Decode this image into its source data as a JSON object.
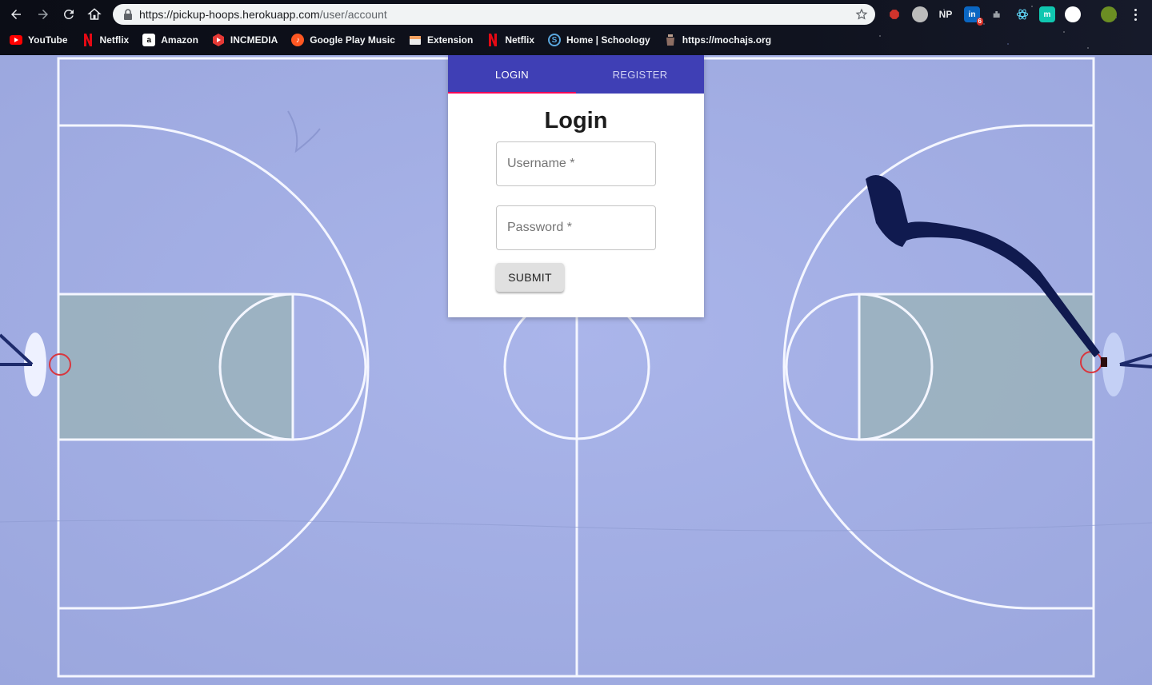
{
  "browser": {
    "url_host": "https://pickup-hoops.herokuapp.com",
    "url_path": "/user/account",
    "extensions": [
      {
        "name": "adblock-icon",
        "color": "#d0342c",
        "text": ""
      },
      {
        "name": "circle-ext-icon",
        "color": "#bbbbbb",
        "text": ""
      },
      {
        "name": "np-icon",
        "color": "transparent",
        "text": "NP"
      },
      {
        "name": "linkedin-icon",
        "color": "#0a66c2",
        "text": "in",
        "badge": "6"
      },
      {
        "name": "puzzle-ext-icon",
        "color": "transparent",
        "text": ""
      },
      {
        "name": "react-devtools-icon",
        "color": "transparent",
        "text": ""
      },
      {
        "name": "m-ext-icon",
        "color": "#10c7b0",
        "text": "m"
      },
      {
        "name": "white-circle-ext-icon",
        "color": "#ffffff",
        "text": ""
      },
      {
        "name": "profile-avatar-icon",
        "color": "#6b8e23",
        "text": ""
      }
    ],
    "bookmarks": [
      {
        "label": "YouTube",
        "icon": "youtube-icon",
        "color": "#ff0000"
      },
      {
        "label": "Netflix",
        "icon": "netflix-icon",
        "color": "#e50914"
      },
      {
        "label": "Amazon",
        "icon": "amazon-icon",
        "color": "#ffffff"
      },
      {
        "label": "INCMEDIA",
        "icon": "incmedia-icon",
        "color": "#e53935"
      },
      {
        "label": "Google Play Music",
        "icon": "google-play-music-icon",
        "color": "#ff5722"
      },
      {
        "label": "Extension",
        "icon": "extension-icon",
        "color": "#f4a261"
      },
      {
        "label": "Netflix",
        "icon": "netflix-icon",
        "color": "#e50914"
      },
      {
        "label": "Home | Schoology",
        "icon": "schoology-icon",
        "color": "#5aa7de"
      },
      {
        "label": "https://mochajs.org",
        "icon": "mocha-icon",
        "color": "#8d6e63"
      }
    ]
  },
  "login": {
    "tabs": [
      {
        "label": "LOGIN",
        "active": true
      },
      {
        "label": "REGISTER",
        "active": false
      }
    ],
    "title": "Login",
    "username_placeholder": "Username *",
    "password_placeholder": "Password *",
    "submit_label": "SUBMIT",
    "accent_color": "#3f3fb5",
    "indicator_color": "#f50057"
  }
}
